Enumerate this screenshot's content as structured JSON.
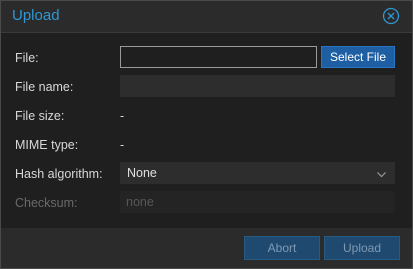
{
  "dialog": {
    "title": "Upload",
    "accent_color": "#2f97d3",
    "close_icon": "close-circle-icon"
  },
  "form": {
    "file": {
      "label": "File:",
      "value": "",
      "button_label": "Select File"
    },
    "file_name": {
      "label": "File name:",
      "value": ""
    },
    "file_size": {
      "label": "File size:",
      "value": "-"
    },
    "mime_type": {
      "label": "MIME type:",
      "value": "-"
    },
    "hash_algorithm": {
      "label": "Hash algorithm:",
      "selected": "None"
    },
    "checksum": {
      "label": "Checksum:",
      "placeholder": "none",
      "disabled": true
    }
  },
  "footer": {
    "abort_label": "Abort",
    "upload_label": "Upload",
    "button_color": "#20496f"
  }
}
